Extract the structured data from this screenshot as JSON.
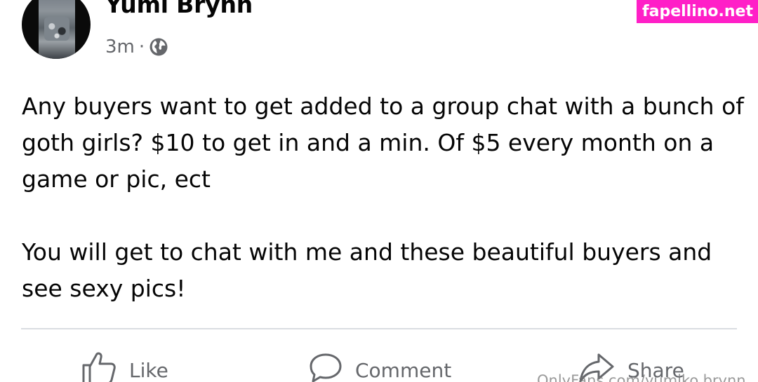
{
  "post": {
    "author": "Yumi Brynn",
    "timestamp": "3m",
    "separator": "·",
    "audience_icon": "globe-icon",
    "body": "Any buyers want to get added to a group chat with a bunch of goth girls? $10 to get in and a min. Of $5 every month on a game or pic, ect\n\nYou will get to chat with me and these beautiful buyers and see sexy pics!"
  },
  "actions": {
    "like": {
      "label": "Like",
      "icon": "thumbs-up-icon"
    },
    "comment": {
      "label": "Comment",
      "icon": "speech-bubble-icon"
    },
    "share": {
      "label": "Share",
      "icon": "share-arrow-icon"
    }
  },
  "watermarks": {
    "top": "fapellino.net",
    "bottom": "OnlyFans.com/yumiko.brynn"
  },
  "colors": {
    "text": "#050505",
    "secondary": "#65676b",
    "divider": "#dadde1",
    "watermark_bg": "#ff1fc7"
  }
}
